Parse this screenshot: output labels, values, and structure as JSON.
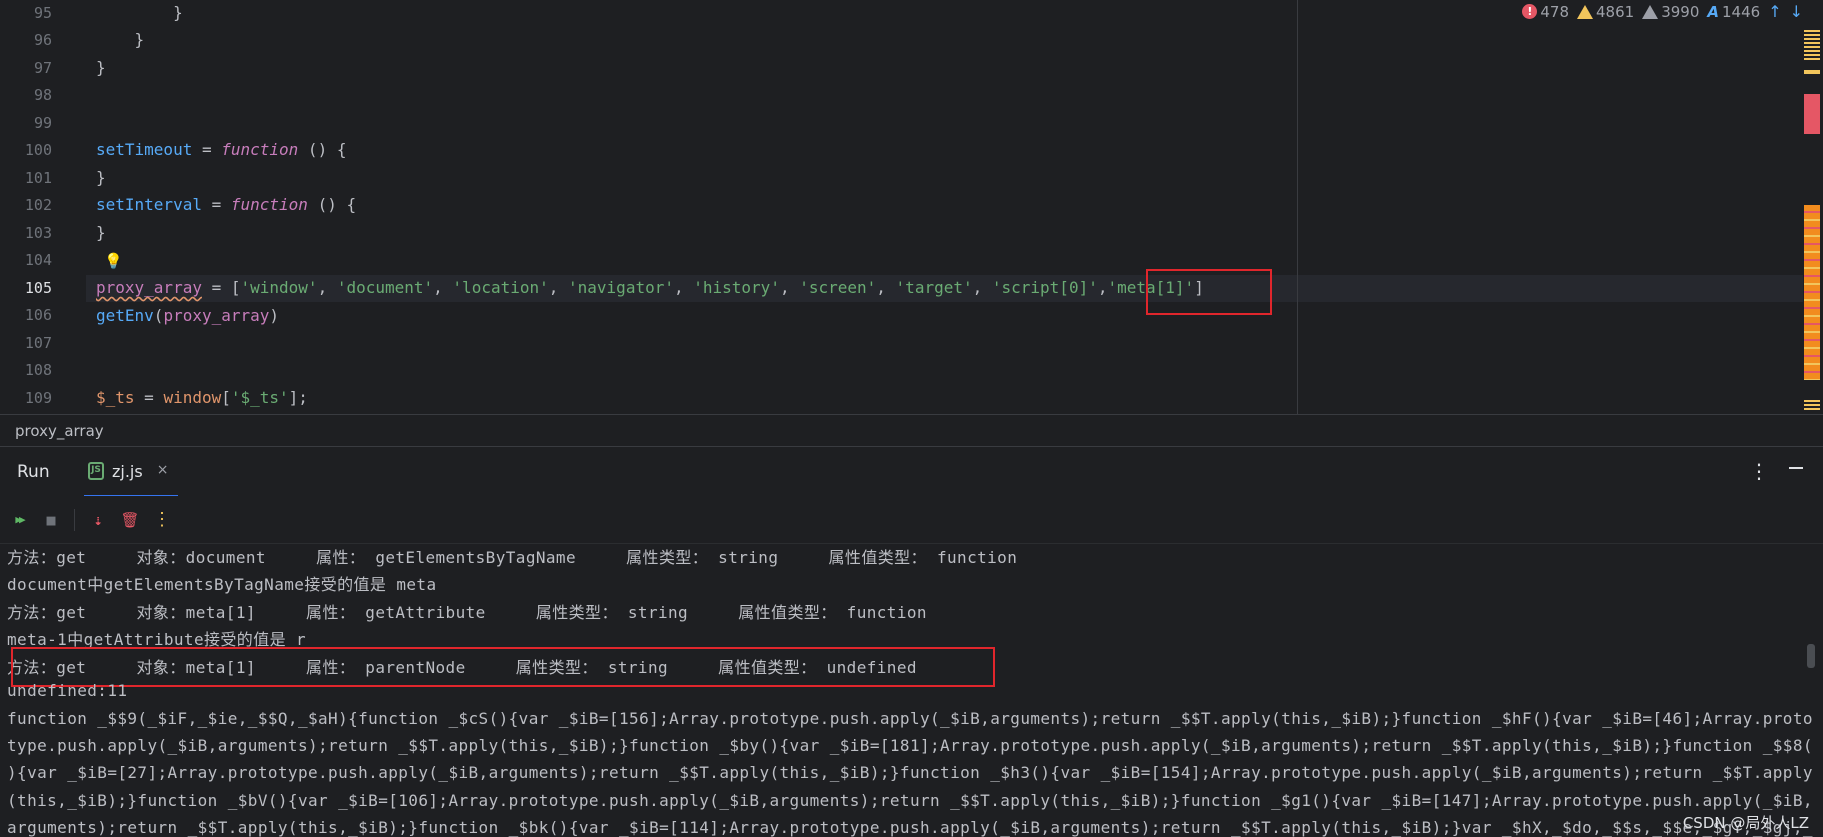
{
  "editor": {
    "lines": [
      {
        "num": "95",
        "code": "        }"
      },
      {
        "num": "96",
        "code": "    }"
      },
      {
        "num": "97",
        "code": "}"
      },
      {
        "num": "98",
        "code": ""
      },
      {
        "num": "99",
        "code": ""
      },
      {
        "num": "100",
        "a": "setTimeout",
        "b": " = ",
        "c": "function",
        "d": " () {"
      },
      {
        "num": "101",
        "code": "}"
      },
      {
        "num": "102",
        "a": "setInterval",
        "b": " = ",
        "c": "function",
        "d": " () {"
      },
      {
        "num": "103",
        "code": "}"
      },
      {
        "num": "104",
        "code": ""
      },
      {
        "num": "105",
        "var": "proxy_array",
        "eq": " = [",
        "items": [
          "'window'",
          "'document'",
          "'location'",
          "'navigator'",
          "'history'",
          "'screen'",
          "'target'",
          "'script[0]'",
          "'meta[1]'"
        ],
        "close": "]"
      },
      {
        "num": "106",
        "fn": "getEnv",
        "arg_open": "(",
        "arg": "proxy_array",
        "arg_close": ")"
      },
      {
        "num": "107",
        "code": ""
      },
      {
        "num": "108",
        "code": ""
      },
      {
        "num": "109",
        "var": "$_ts",
        "eq": " = ",
        "glob": "window",
        "lb": "[",
        "key": "'$_ts'",
        "rb": "];"
      }
    ],
    "inspections": {
      "errors": "478",
      "warnings": "4861",
      "weak_warnings": "3990",
      "typos": "1446",
      "typo_glyph": "A",
      "error_glyph": "!",
      "up_arrow": "↑",
      "down_arrow": "↓"
    },
    "intention_bulb": "💡",
    "breadcrumb": "proxy_array",
    "colors": {
      "accent": "#3574f0",
      "highlight_box": "#e0262c"
    }
  },
  "run_panel": {
    "title": "Run",
    "tab_label": "zj.js",
    "tab_icon": "JS",
    "close_glyph": "×",
    "more_glyph": "⋮",
    "toolbar": {
      "rerun": "▶▶",
      "stop": "■",
      "scroll_end": "⇣",
      "clear": "🗑",
      "more": "⋮"
    }
  },
  "console": {
    "lines": [
      "方法：get     对象：document     属性： getElementsByTagName     属性类型： string     属性值类型： function",
      "document中getElementsByTagName接受的值是 meta",
      "方法：get     对象：meta[1]     属性： getAttribute     属性类型： string     属性值类型： function",
      "meta-1中getAttribute接受的值是 r",
      "方法：get     对象：meta[1]     属性： parentNode     属性类型： string     属性值类型： undefined",
      "undefined:11",
      "function _$$9(_$iF,_$ie,_$$Q,_$aH){function _$cS(){var _$iB=[156];Array.prototype.push.apply(_$iB,arguments);return _$$T.apply(this,_$iB);}function _$hF(){var _$iB=[46];Array.proto",
      "type.push.apply(_$iB,arguments);return _$$T.apply(this,_$iB);}function _$by(){var _$iB=[181];Array.prototype.push.apply(_$iB,arguments);return _$$T.apply(this,_$iB);}function _$$8(",
      "){var _$iB=[27];Array.prototype.push.apply(_$iB,arguments);return _$$T.apply(this,_$iB);}function _$h3(){var _$iB=[154];Array.prototype.push.apply(_$iB,arguments);return _$$T.apply",
      "(this,_$iB);}function _$bV(){var _$iB=[106];Array.prototype.push.apply(_$iB,arguments);return _$$T.apply(this,_$iB);}function _$g1(){var _$iB=[147];Array.prototype.push.apply(_$iB,",
      "arguments);return _$$T.apply(this,_$iB);}function _$bk(){var _$iB=[114];Array.prototype.push.apply(_$iB,arguments);return _$$T.apply(this,_$iB);}var _$hX,_$do,_$$s,_$$e,_$gY,_$gj,_"
    ],
    "watermark": "CSDN @局外人LZ"
  }
}
